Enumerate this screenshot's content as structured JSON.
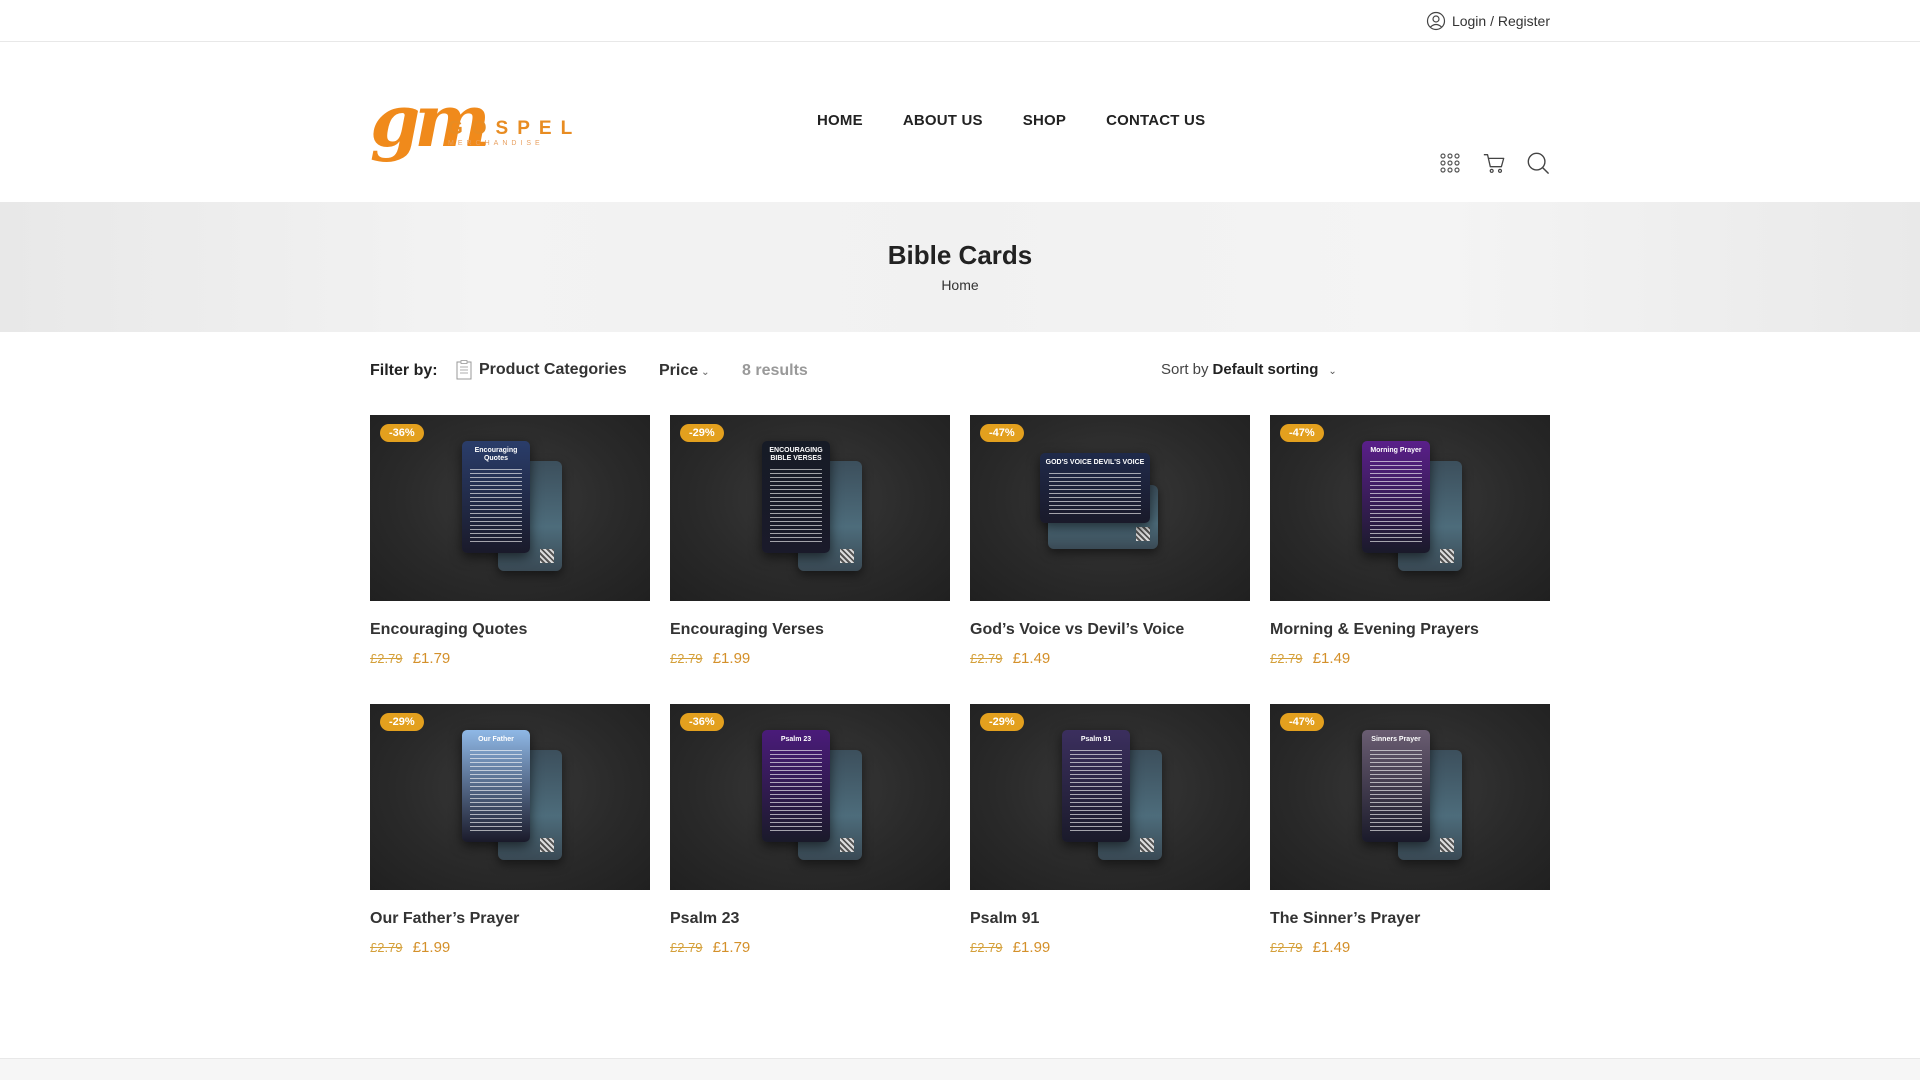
{
  "topbar": {
    "login_label": "Login / Register",
    "login_icon": "user-icon"
  },
  "header": {
    "logo": {
      "mark": "gm",
      "word": "GOSPEL",
      "sub": "MERCHANDISE"
    },
    "nav": [
      "HOME",
      "ABOUT US",
      "SHOP",
      "CONTACT US"
    ],
    "icons": [
      "grid-icon",
      "cart-icon",
      "search-icon"
    ]
  },
  "banner": {
    "title": "Bible Cards",
    "breadcrumb": "Home"
  },
  "filters": {
    "label": "Filter by:",
    "categories": "Product Categories",
    "price": "Price",
    "results": "8 results",
    "sort_prefix": "Sort by",
    "sort_value": "Default sorting"
  },
  "colors": {
    "accent": "#e3a01e",
    "price": "#d4902a",
    "logo": "#f08a1b"
  },
  "products": [
    {
      "name": "Encouraging Quotes",
      "badge": "-36%",
      "old_price": "£2.79",
      "price": "£1.79",
      "card_title": "Encouraging Quotes",
      "card_color": "#2a3d6a",
      "layout": "tall"
    },
    {
      "name": "Encouraging Verses",
      "badge": "-29%",
      "old_price": "£2.79",
      "price": "£1.99",
      "card_title": "ENCOURAGING BIBLE VERSES",
      "card_color": "#161b26",
      "layout": "tall"
    },
    {
      "name": "God’s Voice vs Devil’s Voice",
      "badge": "-47%",
      "old_price": "£2.79",
      "price": "£1.49",
      "card_title": "GOD'S VOICE   DEVIL'S VOICE",
      "card_color": "#1f2a4a",
      "layout": "wide"
    },
    {
      "name": "Morning & Evening Prayers",
      "badge": "-47%",
      "old_price": "£2.79",
      "price": "£1.49",
      "card_title": "Morning Prayer",
      "card_color": "#5a1f8a",
      "layout": "tall"
    },
    {
      "name": "Our Father’s Prayer",
      "badge": "-29%",
      "old_price": "£2.79",
      "price": "£1.99",
      "card_title": "Our Father",
      "card_color": "#8fb8e6",
      "layout": "tall"
    },
    {
      "name": "Psalm 23",
      "badge": "-36%",
      "old_price": "£2.79",
      "price": "£1.79",
      "card_title": "Psalm 23",
      "card_color": "#4a1b7a",
      "layout": "tall"
    },
    {
      "name": "Psalm 91",
      "badge": "-29%",
      "old_price": "£2.79",
      "price": "£1.99",
      "card_title": "Psalm 91",
      "card_color": "#3b2f5e",
      "layout": "tall"
    },
    {
      "name": "The Sinner’s Prayer",
      "badge": "-47%",
      "old_price": "£2.79",
      "price": "£1.49",
      "card_title": "Sinners Prayer",
      "card_color": "#6a5d72",
      "layout": "tall"
    }
  ]
}
